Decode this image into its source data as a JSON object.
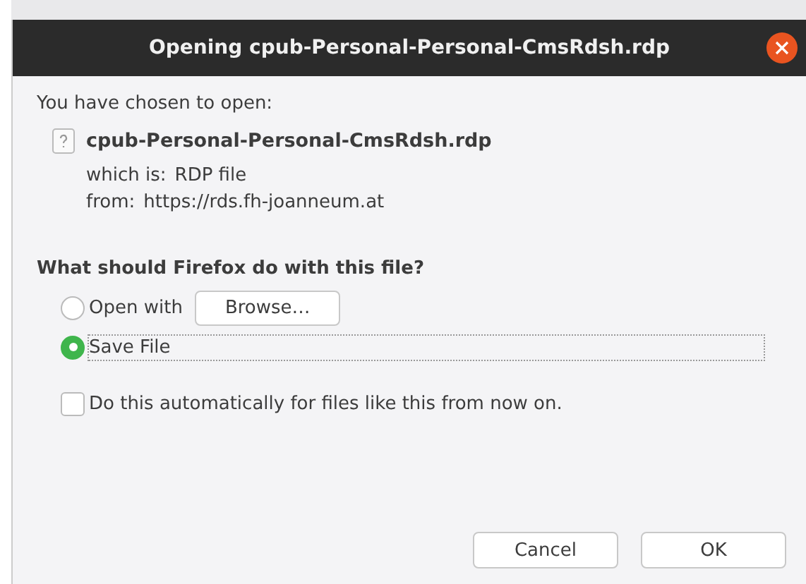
{
  "window": {
    "title": "Opening cpub-Personal-Personal-CmsRdsh.rdp"
  },
  "intro": "You have chosen to open:",
  "file": {
    "name": "cpub-Personal-Personal-CmsRdsh.rdp",
    "type_label": "which is:",
    "type": "RDP file",
    "from_label": "from:",
    "from": "https://rds.fh-joanneum.at"
  },
  "question": "What should Firefox do with this file?",
  "options": [
    {
      "label": "Open with",
      "selected": false,
      "focused": false,
      "browse": "Browse…"
    },
    {
      "label": "Save File",
      "selected": true,
      "focused": true
    }
  ],
  "remember": {
    "label": "Do this automatically for files like this from now on.",
    "checked": false
  },
  "buttons": [
    "Cancel",
    "OK"
  ]
}
